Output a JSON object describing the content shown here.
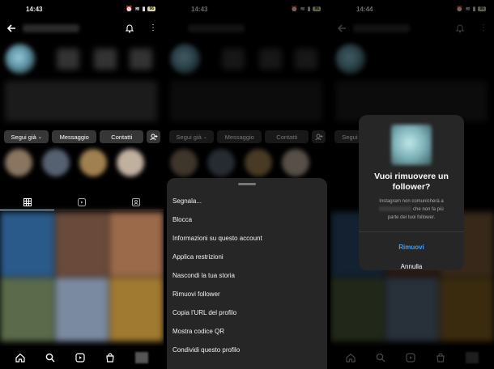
{
  "panels": [
    {
      "time": "14:43",
      "battery": "96",
      "profile_buttons": [
        "Segui già",
        "Messaggio",
        "Contatti"
      ],
      "tabs": [
        "grid-icon",
        "reels-icon",
        "tagged-icon"
      ]
    },
    {
      "time": "14:43",
      "battery": "96",
      "profile_buttons": [
        "Segui già",
        "Messaggio",
        "Contatti"
      ],
      "menu_items": [
        "Segnala...",
        "Blocca",
        "Informazioni su questo account",
        "Applica restrizioni",
        "Nascondi la tua storia",
        "Rimuovi follower",
        "Copia l'URL del profilo",
        "Mostra codice QR",
        "Condividi questo profilo"
      ]
    },
    {
      "time": "14:44",
      "battery": "96",
      "profile_buttons": [
        "Segui già"
      ],
      "modal": {
        "title": "Vuoi rimuovere un follower?",
        "body_line1": "Instagram non comunicherà a",
        "body_line2": "che non fa più",
        "body_line3": "parte dei tuoi follower.",
        "remove_label": "Rimuovi",
        "cancel_label": "Annulla"
      }
    }
  ],
  "colors": {
    "background": "#000000",
    "sheet": "#262626",
    "button": "#363636",
    "accent_blue": "#4a9cf2"
  },
  "nav_icons": [
    "home-icon",
    "search-icon",
    "reels-icon",
    "shop-icon",
    "profile-avatar"
  ]
}
